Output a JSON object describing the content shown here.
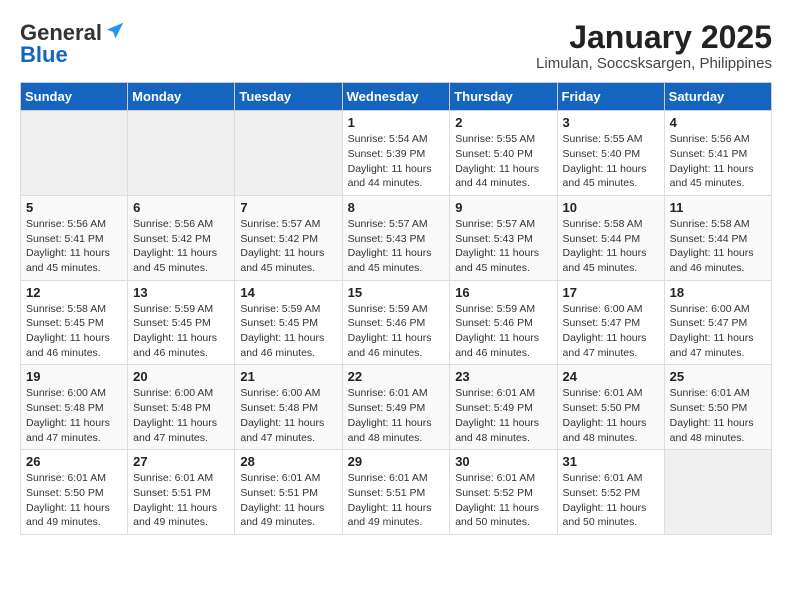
{
  "header": {
    "logo_general": "General",
    "logo_blue": "Blue",
    "title": "January 2025",
    "subtitle": "Limulan, Soccsksargen, Philippines"
  },
  "days_of_week": [
    "Sunday",
    "Monday",
    "Tuesday",
    "Wednesday",
    "Thursday",
    "Friday",
    "Saturday"
  ],
  "weeks": [
    [
      {
        "day": "",
        "detail": ""
      },
      {
        "day": "",
        "detail": ""
      },
      {
        "day": "",
        "detail": ""
      },
      {
        "day": "1",
        "detail": "Sunrise: 5:54 AM\nSunset: 5:39 PM\nDaylight: 11 hours\nand 44 minutes."
      },
      {
        "day": "2",
        "detail": "Sunrise: 5:55 AM\nSunset: 5:40 PM\nDaylight: 11 hours\nand 44 minutes."
      },
      {
        "day": "3",
        "detail": "Sunrise: 5:55 AM\nSunset: 5:40 PM\nDaylight: 11 hours\nand 45 minutes."
      },
      {
        "day": "4",
        "detail": "Sunrise: 5:56 AM\nSunset: 5:41 PM\nDaylight: 11 hours\nand 45 minutes."
      }
    ],
    [
      {
        "day": "5",
        "detail": "Sunrise: 5:56 AM\nSunset: 5:41 PM\nDaylight: 11 hours\nand 45 minutes."
      },
      {
        "day": "6",
        "detail": "Sunrise: 5:56 AM\nSunset: 5:42 PM\nDaylight: 11 hours\nand 45 minutes."
      },
      {
        "day": "7",
        "detail": "Sunrise: 5:57 AM\nSunset: 5:42 PM\nDaylight: 11 hours\nand 45 minutes."
      },
      {
        "day": "8",
        "detail": "Sunrise: 5:57 AM\nSunset: 5:43 PM\nDaylight: 11 hours\nand 45 minutes."
      },
      {
        "day": "9",
        "detail": "Sunrise: 5:57 AM\nSunset: 5:43 PM\nDaylight: 11 hours\nand 45 minutes."
      },
      {
        "day": "10",
        "detail": "Sunrise: 5:58 AM\nSunset: 5:44 PM\nDaylight: 11 hours\nand 45 minutes."
      },
      {
        "day": "11",
        "detail": "Sunrise: 5:58 AM\nSunset: 5:44 PM\nDaylight: 11 hours\nand 46 minutes."
      }
    ],
    [
      {
        "day": "12",
        "detail": "Sunrise: 5:58 AM\nSunset: 5:45 PM\nDaylight: 11 hours\nand 46 minutes."
      },
      {
        "day": "13",
        "detail": "Sunrise: 5:59 AM\nSunset: 5:45 PM\nDaylight: 11 hours\nand 46 minutes."
      },
      {
        "day": "14",
        "detail": "Sunrise: 5:59 AM\nSunset: 5:45 PM\nDaylight: 11 hours\nand 46 minutes."
      },
      {
        "day": "15",
        "detail": "Sunrise: 5:59 AM\nSunset: 5:46 PM\nDaylight: 11 hours\nand 46 minutes."
      },
      {
        "day": "16",
        "detail": "Sunrise: 5:59 AM\nSunset: 5:46 PM\nDaylight: 11 hours\nand 46 minutes."
      },
      {
        "day": "17",
        "detail": "Sunrise: 6:00 AM\nSunset: 5:47 PM\nDaylight: 11 hours\nand 47 minutes."
      },
      {
        "day": "18",
        "detail": "Sunrise: 6:00 AM\nSunset: 5:47 PM\nDaylight: 11 hours\nand 47 minutes."
      }
    ],
    [
      {
        "day": "19",
        "detail": "Sunrise: 6:00 AM\nSunset: 5:48 PM\nDaylight: 11 hours\nand 47 minutes."
      },
      {
        "day": "20",
        "detail": "Sunrise: 6:00 AM\nSunset: 5:48 PM\nDaylight: 11 hours\nand 47 minutes."
      },
      {
        "day": "21",
        "detail": "Sunrise: 6:00 AM\nSunset: 5:48 PM\nDaylight: 11 hours\nand 47 minutes."
      },
      {
        "day": "22",
        "detail": "Sunrise: 6:01 AM\nSunset: 5:49 PM\nDaylight: 11 hours\nand 48 minutes."
      },
      {
        "day": "23",
        "detail": "Sunrise: 6:01 AM\nSunset: 5:49 PM\nDaylight: 11 hours\nand 48 minutes."
      },
      {
        "day": "24",
        "detail": "Sunrise: 6:01 AM\nSunset: 5:50 PM\nDaylight: 11 hours\nand 48 minutes."
      },
      {
        "day": "25",
        "detail": "Sunrise: 6:01 AM\nSunset: 5:50 PM\nDaylight: 11 hours\nand 48 minutes."
      }
    ],
    [
      {
        "day": "26",
        "detail": "Sunrise: 6:01 AM\nSunset: 5:50 PM\nDaylight: 11 hours\nand 49 minutes."
      },
      {
        "day": "27",
        "detail": "Sunrise: 6:01 AM\nSunset: 5:51 PM\nDaylight: 11 hours\nand 49 minutes."
      },
      {
        "day": "28",
        "detail": "Sunrise: 6:01 AM\nSunset: 5:51 PM\nDaylight: 11 hours\nand 49 minutes."
      },
      {
        "day": "29",
        "detail": "Sunrise: 6:01 AM\nSunset: 5:51 PM\nDaylight: 11 hours\nand 49 minutes."
      },
      {
        "day": "30",
        "detail": "Sunrise: 6:01 AM\nSunset: 5:52 PM\nDaylight: 11 hours\nand 50 minutes."
      },
      {
        "day": "31",
        "detail": "Sunrise: 6:01 AM\nSunset: 5:52 PM\nDaylight: 11 hours\nand 50 minutes."
      },
      {
        "day": "",
        "detail": ""
      }
    ]
  ]
}
